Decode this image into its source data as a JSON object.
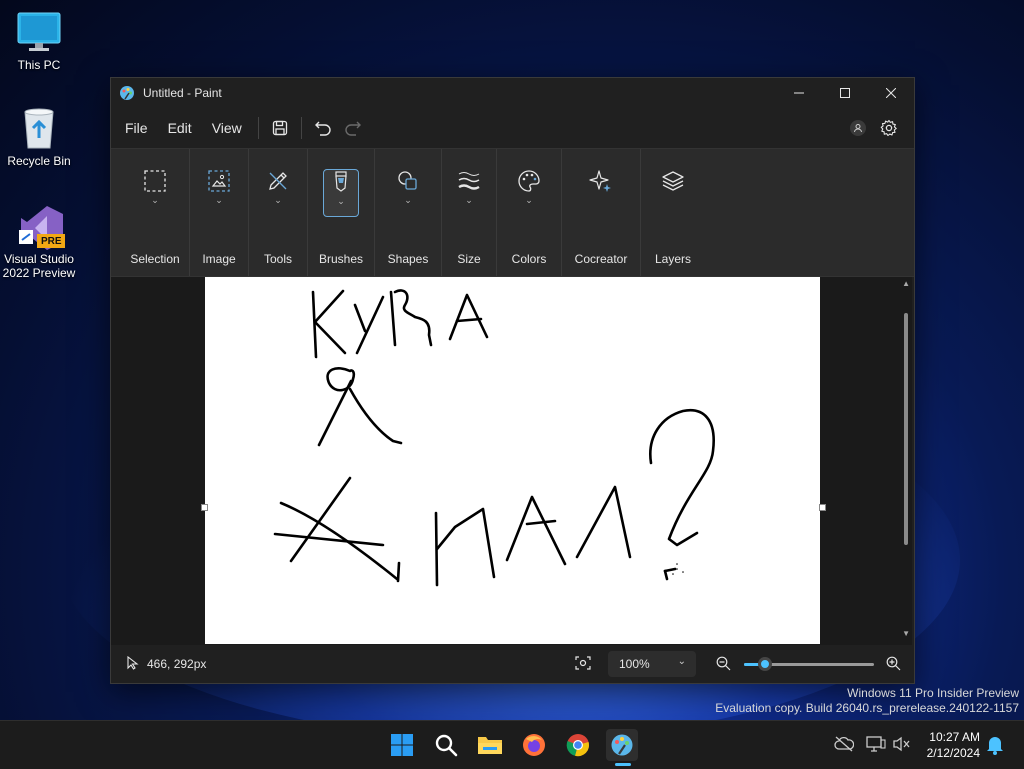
{
  "desktop": {
    "icons": [
      {
        "label": "This PC"
      },
      {
        "label": "Recycle Bin"
      },
      {
        "label": "Visual Studio 2022 Preview",
        "badge": "PRE"
      }
    ],
    "watermark": {
      "line1": "Windows 11 Pro Insider Preview",
      "line2": "Evaluation copy. Build 26040.rs_prerelease.240122-1157"
    }
  },
  "window": {
    "title": "Untitled - Paint",
    "controls": [
      "minimize-icon",
      "maximize-icon",
      "close-icon"
    ]
  },
  "menubar": {
    "file": "File",
    "edit": "Edit",
    "view": "View",
    "icons": [
      "save-icon",
      "undo-icon",
      "redo-icon",
      "account-icon",
      "gear-icon"
    ]
  },
  "ribbon": {
    "groups": [
      {
        "label": "Selection",
        "icon": "selection-icon"
      },
      {
        "label": "Image",
        "icon": "image-icon"
      },
      {
        "label": "Tools",
        "icon": "pencil-icon"
      },
      {
        "label": "Brushes",
        "icon": "brush-icon",
        "active": true
      },
      {
        "label": "Shapes",
        "icon": "shapes-icon"
      },
      {
        "label": "Size",
        "icon": "stroke-size-icon"
      },
      {
        "label": "Colors",
        "icon": "palette-icon"
      },
      {
        "label": "Cocreator",
        "icon": "sparkle-icon"
      },
      {
        "label": "Layers",
        "icon": "layers-icon"
      }
    ]
  },
  "canvas": {
    "drawing_text": "КУРА Я ЖМАЛ?"
  },
  "status": {
    "cursor_position": "466, 292px",
    "zoom": "100%",
    "zoom_level": 0.15
  },
  "taskbar": {
    "time": "10:27 AM",
    "date": "2/12/2024",
    "apps": [
      "start-icon",
      "search-icon",
      "file-explorer-icon",
      "firefox-icon",
      "chrome-icon",
      "paint-icon"
    ]
  },
  "colors": {
    "accent": "#4cc2ff",
    "window_bg": "#202020",
    "ribbon_bg": "#2b2b2b"
  }
}
